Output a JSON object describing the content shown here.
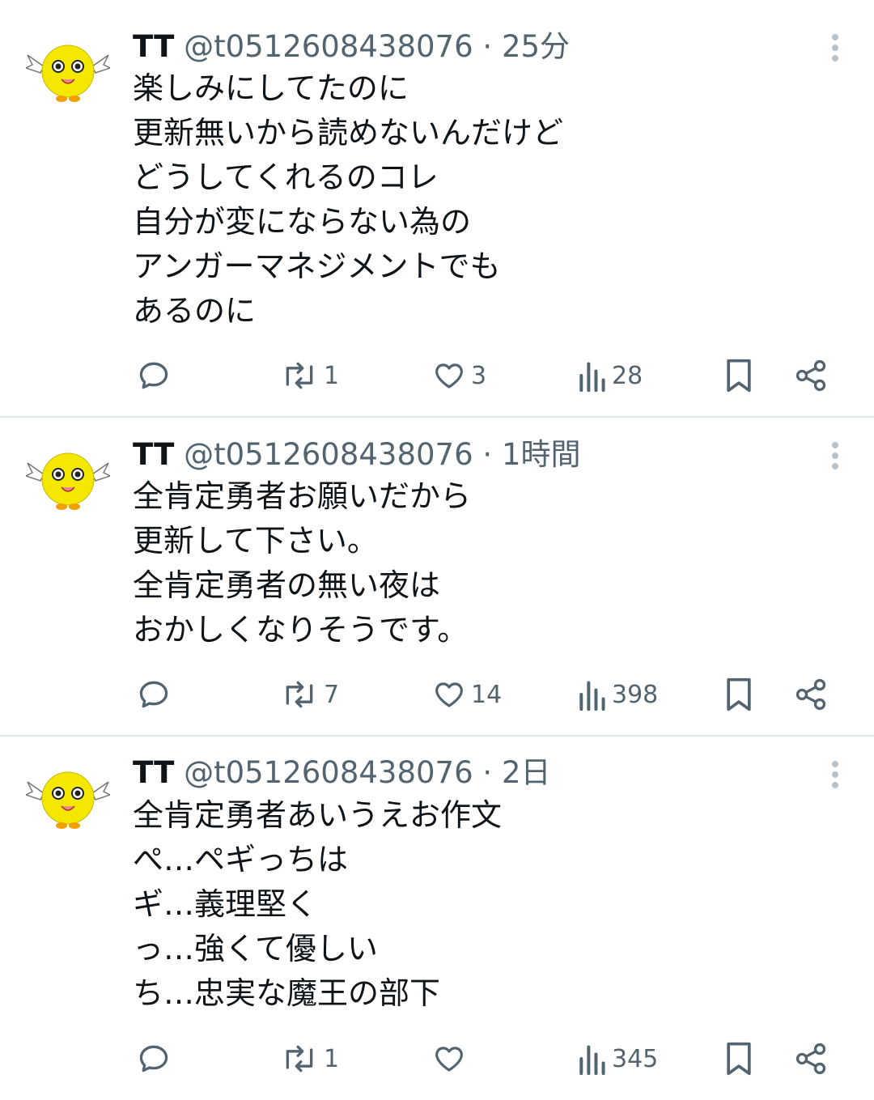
{
  "tweets": [
    {
      "name": "TT",
      "handle": "@t0512608438076",
      "dot": "·",
      "time": "25分",
      "lines": [
        "楽しみにしてたのに",
        "更新無いから読めないんだけど",
        "どうしてくれるのコレ",
        "自分が変にならない為の",
        "アンガーマネジメントでも",
        "あるのに"
      ],
      "retweets": "1",
      "likes": "3",
      "views": "28"
    },
    {
      "name": "TT",
      "handle": "@t0512608438076",
      "dot": "·",
      "time": "1時間",
      "lines": [
        "全肯定勇者お願いだから",
        "更新して下さい。",
        "全肯定勇者の無い夜は",
        "おかしくなりそうです。"
      ],
      "retweets": "7",
      "likes": "14",
      "views": "398"
    },
    {
      "name": "TT",
      "handle": "@t0512608438076",
      "dot": "·",
      "time": "2日",
      "lines": [
        "全肯定勇者あいうえお作文",
        "ぺ…ペギっちは",
        "ギ…義理堅く",
        "っ…強くて優しい",
        "ち…忠実な魔王の部下"
      ],
      "retweets": "1",
      "likes": "",
      "views": "345"
    }
  ],
  "colors": {
    "text": "#0f1419",
    "secondary": "#536471",
    "divider": "#e1e6ea",
    "avatar": "#f5e800"
  },
  "icons": [
    "reply-icon",
    "retweet-icon",
    "like-icon",
    "views-icon",
    "bookmark-icon",
    "share-icon",
    "more-icon"
  ]
}
